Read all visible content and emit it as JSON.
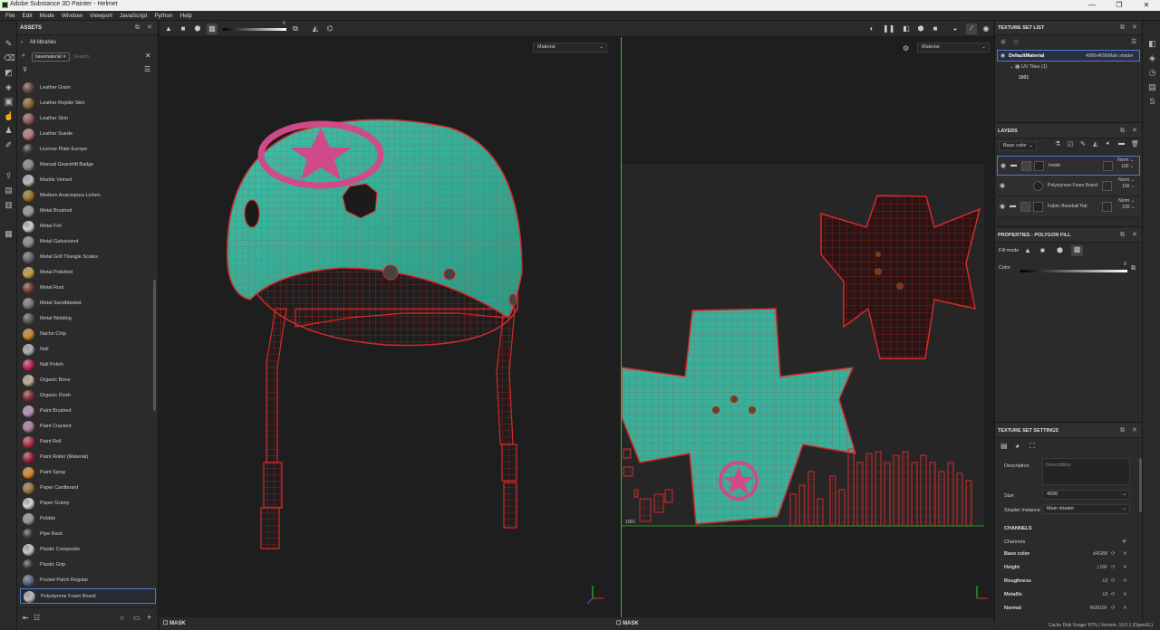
{
  "window": {
    "title": "Adobe Substance 3D Painter - Helmet",
    "controls": [
      "—",
      "❐",
      "✕"
    ]
  },
  "menu": [
    "File",
    "Edit",
    "Mode",
    "Window",
    "Viewport",
    "JavaScript",
    "Python",
    "Help"
  ],
  "assets": {
    "title": "ASSETS",
    "library": "All libraries",
    "filter_tag": "basematerial",
    "search_placeholder": "Search",
    "items": [
      {
        "name": "Leather Grain",
        "color": "#6b4a38"
      },
      {
        "name": "Leather Reptile Skin",
        "color": "#8a6a2c"
      },
      {
        "name": "Leather Skin",
        "color": "#9a5a5a"
      },
      {
        "name": "Leather Suede",
        "color": "#c07a80"
      },
      {
        "name": "License Plate Europe",
        "color": "#3a3a3a"
      },
      {
        "name": "Manual Gearshift Badge",
        "color": "#8a8a8a"
      },
      {
        "name": "Marble Veined",
        "color": "#bdbdbd"
      },
      {
        "name": "Medium Acarospora Lichen",
        "color": "#a07a20"
      },
      {
        "name": "Metal Brushed",
        "color": "#9a9a9a"
      },
      {
        "name": "Metal Foil",
        "color": "#d0d0d0"
      },
      {
        "name": "Metal Galvanized",
        "color": "#8c8c8c"
      },
      {
        "name": "Metal Grill Triangle Scales",
        "color": "#6a6a6a"
      },
      {
        "name": "Metal Polished",
        "color": "#c8a040"
      },
      {
        "name": "Metal Rust",
        "color": "#7a4028"
      },
      {
        "name": "Metal Sandblasted",
        "color": "#7a7a7a"
      },
      {
        "name": "Metal Welding",
        "color": "#5a5a5a"
      },
      {
        "name": "Nacho Chip",
        "color": "#d08a20"
      },
      {
        "name": "Nail",
        "color": "#b0b0b0"
      },
      {
        "name": "Nail Polish",
        "color": "#d02050"
      },
      {
        "name": "Organic Bone",
        "color": "#c0b090"
      },
      {
        "name": "Organic Flesh",
        "color": "#8a3030"
      },
      {
        "name": "Paint Brushed",
        "color": "#c090c0"
      },
      {
        "name": "Paint Cracked",
        "color": "#b080a0"
      },
      {
        "name": "Paint Roll",
        "color": "#c03050"
      },
      {
        "name": "Paint Roller (Material)",
        "color": "#b02040"
      },
      {
        "name": "Paint Spray",
        "color": "#e08a20"
      },
      {
        "name": "Paper Cardboard",
        "color": "#a07a40"
      },
      {
        "name": "Paper Grainy",
        "color": "#d8d8d8"
      },
      {
        "name": "Pebble",
        "color": "#9a9a9a"
      },
      {
        "name": "Pipe Rack",
        "color": "#3a3a3a"
      },
      {
        "name": "Plastic Composite",
        "color": "#c8c8c8"
      },
      {
        "name": "Plastic Grip",
        "color": "#3a3a3a"
      },
      {
        "name": "Pocket Patch Regular",
        "color": "#5a6a8a"
      },
      {
        "name": "Polystyrene Foam Board",
        "color": "#bdbdbd"
      }
    ]
  },
  "viewport": {
    "left_dropdown": "Material",
    "right_dropdown": "Material",
    "mask_label": "MASK",
    "uv_tile_label": "1001",
    "slider_value": "0"
  },
  "texture_set_list": {
    "title": "TEXTURE SET LIST",
    "set_name": "DefaultMaterial",
    "resolution": "4096x4096",
    "shader": "Main shader",
    "uv_tiles": "UV Tiles (1)",
    "tile": "1001"
  },
  "layers": {
    "title": "LAYERS",
    "channel": "Base color",
    "items": [
      {
        "name": "Inside",
        "blend": "Norm",
        "opacity": "100"
      },
      {
        "name": "Polystyrene Foam Board",
        "blend": "Norm",
        "opacity": "100"
      },
      {
        "name": "Fabric Baseball Hat",
        "blend": "Norm",
        "opacity": "100"
      }
    ]
  },
  "properties": {
    "title": "PROPERTIES - POLYGON FILL",
    "fill_mode_label": "Fill mode",
    "color_label": "Color",
    "color_value": "0"
  },
  "texture_set_settings": {
    "title": "TEXTURE SET SETTINGS",
    "description_label": "Description",
    "description_placeholder": "Description",
    "size_label": "Size",
    "size_value": "4096",
    "shader_label": "Shader Instance",
    "shader_value": "Main shader",
    "channels_header": "CHANNELS",
    "channels_label": "Channels",
    "channels": [
      {
        "name": "Base color",
        "format": "sRGB8"
      },
      {
        "name": "Height",
        "format": "L16F"
      },
      {
        "name": "Roughness",
        "format": "L8"
      },
      {
        "name": "Metallic",
        "format": "L8"
      },
      {
        "name": "Normal",
        "format": "RGB16F"
      }
    ]
  },
  "status": {
    "text": "Cache Disk Usage:  87%  |  Version: 10.0.1 (OpenGL)"
  },
  "colors": {
    "accent": "#4a7bd1",
    "helmet": "#3ab09a",
    "star": "#d04a8a",
    "wire": "#d42a2a"
  }
}
